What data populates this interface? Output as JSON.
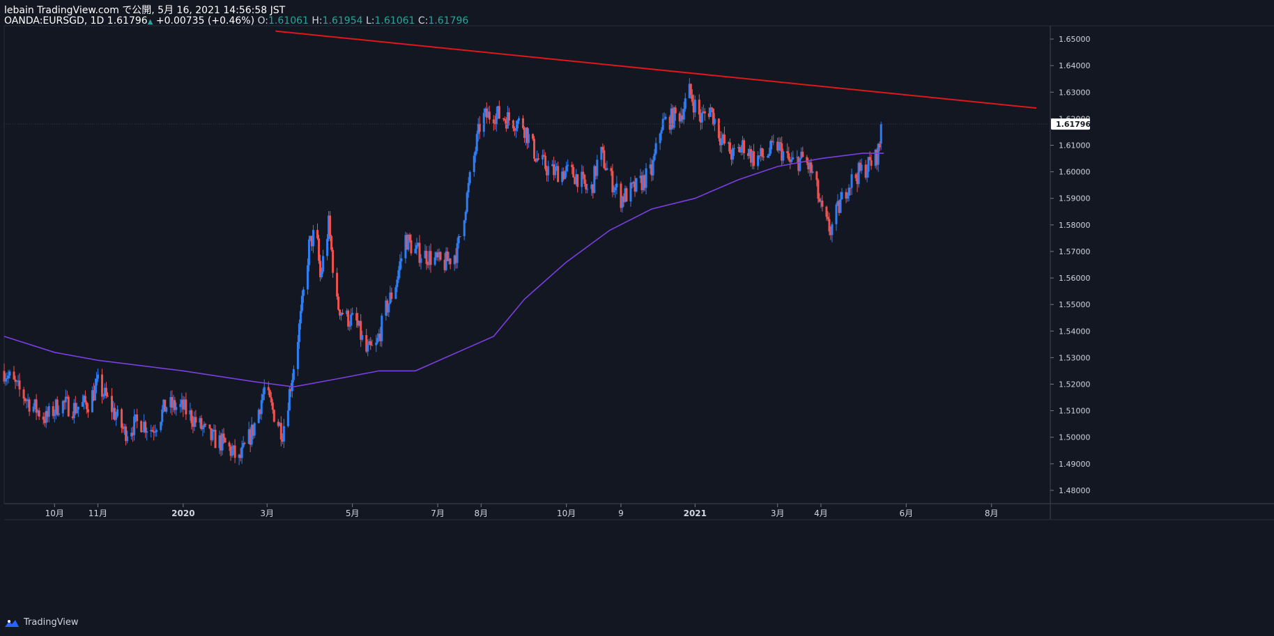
{
  "header": {
    "publish_line": "lebain TradingView.com で公開, 5月 16, 2021 14:56:58 JST",
    "symbol": "OANDA:EURSGD, 1D",
    "last": "1.61796",
    "change_arrow": "▲",
    "change": "+0.00735 (+0.46%)",
    "open_label": "O:",
    "open": "1.61061",
    "high_label": "H:",
    "high": "1.61954",
    "low_label": "L:",
    "low": "1.61061",
    "close_label": "C:",
    "close": "1.61796"
  },
  "footer": {
    "brand": "TradingView",
    "icon": "tradingview-logo-icon"
  },
  "colors": {
    "background": "#131722",
    "up": "#2e7ff6",
    "down": "#ef5350",
    "ma": "#7b3fe4",
    "trendline": "#e0181b",
    "axis_text": "#d1d4dc",
    "last_badge_bg": "#ffffff",
    "last_badge_text": "#131722"
  },
  "chart_data": {
    "type": "candlestick",
    "symbol": "OANDA:EURSGD",
    "interval": "1D",
    "y_range": [
      1.475,
      1.655
    ],
    "y_ticks": [
      "1.65000",
      "1.64000",
      "1.63000",
      "1.62000",
      "1.61000",
      "1.60000",
      "1.59000",
      "1.58000",
      "1.57000",
      "1.56000",
      "1.55000",
      "1.54000",
      "1.53000",
      "1.52000",
      "1.51000",
      "1.50000",
      "1.49000",
      "1.48000"
    ],
    "last_price": "1.61796",
    "x_labels": [
      {
        "label": "10月",
        "date": "2019-10-01"
      },
      {
        "label": "11月",
        "date": "2019-11-01"
      },
      {
        "label": "2020",
        "date": "2020-01-01"
      },
      {
        "label": "3月",
        "date": "2020-03-01"
      },
      {
        "label": "5月",
        "date": "2020-05-01"
      },
      {
        "label": "7月",
        "date": "2020-07-01"
      },
      {
        "label": "8月",
        "date": "2020-08-01"
      },
      {
        "label": "10月",
        "date": "2020-10-01"
      },
      {
        "label": "9",
        "date": "2020-11-09"
      },
      {
        "label": "2021",
        "date": "2021-01-01"
      },
      {
        "label": "3月",
        "date": "2021-03-01"
      },
      {
        "label": "4月",
        "date": "2021-04-01"
      },
      {
        "label": "6月",
        "date": "2021-06-01"
      },
      {
        "label": "8月",
        "date": "2021-08-01"
      }
    ],
    "price_path": [
      [
        "2019-08-26",
        1.525
      ],
      [
        "2019-09-05",
        1.518
      ],
      [
        "2019-09-15",
        1.512
      ],
      [
        "2019-09-25",
        1.507
      ],
      [
        "2019-10-05",
        1.513
      ],
      [
        "2019-10-15",
        1.511
      ],
      [
        "2019-10-25",
        1.513
      ],
      [
        "2019-11-01",
        1.52
      ],
      [
        "2019-11-10",
        1.512
      ],
      [
        "2019-11-20",
        1.502
      ],
      [
        "2019-12-01",
        1.506
      ],
      [
        "2019-12-10",
        1.503
      ],
      [
        "2019-12-20",
        1.512
      ],
      [
        "2020-01-01",
        1.511
      ],
      [
        "2020-01-10",
        1.506
      ],
      [
        "2020-01-20",
        1.5
      ],
      [
        "2020-02-01",
        1.497
      ],
      [
        "2020-02-10",
        1.491
      ],
      [
        "2020-02-20",
        1.503
      ],
      [
        "2020-02-28",
        1.518
      ],
      [
        "2020-03-05",
        1.51
      ],
      [
        "2020-03-12",
        1.502
      ],
      [
        "2020-03-18",
        1.52
      ],
      [
        "2020-03-25",
        1.545
      ],
      [
        "2020-03-31",
        1.572
      ],
      [
        "2020-04-05",
        1.578
      ],
      [
        "2020-04-08",
        1.56
      ],
      [
        "2020-04-14",
        1.58
      ],
      [
        "2020-04-20",
        1.55
      ],
      [
        "2020-04-27",
        1.545
      ],
      [
        "2020-05-04",
        1.543
      ],
      [
        "2020-05-11",
        1.532
      ],
      [
        "2020-05-18",
        1.534
      ],
      [
        "2020-05-25",
        1.548
      ],
      [
        "2020-06-01",
        1.558
      ],
      [
        "2020-06-08",
        1.575
      ],
      [
        "2020-06-15",
        1.57
      ],
      [
        "2020-06-25",
        1.568
      ],
      [
        "2020-07-05",
        1.565
      ],
      [
        "2020-07-15",
        1.57
      ],
      [
        "2020-07-25",
        1.6
      ],
      [
        "2020-08-01",
        1.62
      ],
      [
        "2020-08-10",
        1.622
      ],
      [
        "2020-08-20",
        1.62
      ],
      [
        "2020-08-31",
        1.618
      ],
      [
        "2020-09-10",
        1.605
      ],
      [
        "2020-09-20",
        1.6
      ],
      [
        "2020-10-01",
        1.6
      ],
      [
        "2020-10-10",
        1.598
      ],
      [
        "2020-10-18",
        1.591
      ],
      [
        "2020-10-25",
        1.608
      ],
      [
        "2020-11-01",
        1.598
      ],
      [
        "2020-11-09",
        1.59
      ],
      [
        "2020-11-20",
        1.594
      ],
      [
        "2020-12-01",
        1.6
      ],
      [
        "2020-12-08",
        1.618
      ],
      [
        "2020-12-15",
        1.62
      ],
      [
        "2020-12-22",
        1.622
      ],
      [
        "2020-12-28",
        1.63
      ],
      [
        "2021-01-05",
        1.62
      ],
      [
        "2021-01-12",
        1.624
      ],
      [
        "2021-01-20",
        1.612
      ],
      [
        "2021-01-28",
        1.606
      ],
      [
        "2021-02-05",
        1.61
      ],
      [
        "2021-02-12",
        1.605
      ],
      [
        "2021-02-20",
        1.606
      ],
      [
        "2021-03-01",
        1.61
      ],
      [
        "2021-03-10",
        1.603
      ],
      [
        "2021-03-20",
        1.605
      ],
      [
        "2021-03-27",
        1.598
      ],
      [
        "2021-04-01",
        1.586
      ],
      [
        "2021-04-05",
        1.58
      ],
      [
        "2021-04-08",
        1.578
      ],
      [
        "2021-04-12",
        1.584
      ],
      [
        "2021-04-20",
        1.595
      ],
      [
        "2021-04-27",
        1.599
      ],
      [
        "2021-05-04",
        1.602
      ],
      [
        "2021-05-10",
        1.605
      ],
      [
        "2021-05-14",
        1.611
      ],
      [
        "2021-05-16",
        1.618
      ]
    ],
    "ma_path": [
      [
        "2019-08-26",
        1.538
      ],
      [
        "2019-10-01",
        1.532
      ],
      [
        "2019-11-01",
        1.529
      ],
      [
        "2020-01-01",
        1.525
      ],
      [
        "2020-02-20",
        1.521
      ],
      [
        "2020-03-20",
        1.519
      ],
      [
        "2020-04-20",
        1.522
      ],
      [
        "2020-05-20",
        1.525
      ],
      [
        "2020-06-15",
        1.525
      ],
      [
        "2020-07-15",
        1.532
      ],
      [
        "2020-08-10",
        1.538
      ],
      [
        "2020-09-01",
        1.552
      ],
      [
        "2020-10-01",
        1.566
      ],
      [
        "2020-11-01",
        1.578
      ],
      [
        "2020-12-01",
        1.586
      ],
      [
        "2021-01-01",
        1.59
      ],
      [
        "2021-02-01",
        1.597
      ],
      [
        "2021-03-01",
        1.602
      ],
      [
        "2021-04-01",
        1.605
      ],
      [
        "2021-05-01",
        1.607
      ],
      [
        "2021-05-16",
        1.607
      ]
    ],
    "trendline": [
      [
        "2020-03-07",
        1.653
      ],
      [
        "2021-09-02",
        1.624
      ]
    ]
  }
}
